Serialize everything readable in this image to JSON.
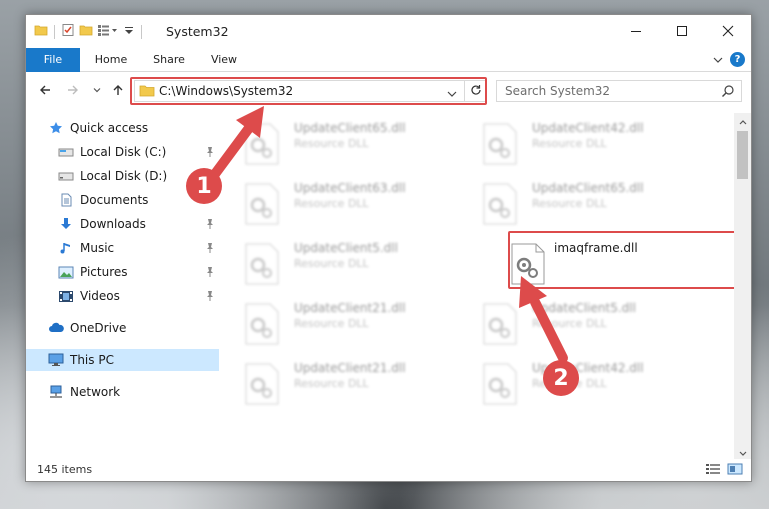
{
  "window": {
    "title": "System32",
    "controls": {
      "minimize": "minimize",
      "maximize": "maximize",
      "close": "close"
    }
  },
  "ribbon": {
    "tabs": [
      {
        "label": "File"
      },
      {
        "label": "Home"
      },
      {
        "label": "Share"
      },
      {
        "label": "View"
      }
    ],
    "help": "?"
  },
  "address": {
    "path": "C:\\Windows\\System32",
    "search_placeholder": "Search System32"
  },
  "nav_pane": {
    "items": [
      {
        "label": "Quick access",
        "icon": "star-icon"
      },
      {
        "label": "Local Disk (C:)",
        "icon": "drive-icon",
        "pinned": true
      },
      {
        "label": "Local Disk (D:)",
        "icon": "drive-icon",
        "pinned": false
      },
      {
        "label": "Documents",
        "icon": "documents-icon",
        "pinned": false
      },
      {
        "label": "Downloads",
        "icon": "download-icon",
        "pinned": true
      },
      {
        "label": "Music",
        "icon": "music-icon",
        "pinned": true
      },
      {
        "label": "Pictures",
        "icon": "pictures-icon",
        "pinned": true
      },
      {
        "label": "Videos",
        "icon": "videos-icon",
        "pinned": true
      },
      {
        "label": "OneDrive",
        "icon": "cloud-icon"
      },
      {
        "label": "This PC",
        "icon": "computer-icon",
        "selected": true
      },
      {
        "label": "Network",
        "icon": "network-icon"
      }
    ]
  },
  "files": [
    {
      "name": "UpdateClient65.dll",
      "type": "Resource DLL"
    },
    {
      "name": "UpdateClient42.dll",
      "type": "Resource DLL"
    },
    {
      "name": "UpdateClient63.dll",
      "type": "Resource DLL"
    },
    {
      "name": "UpdateClient65.dll",
      "type": "Resource DLL"
    },
    {
      "name": "UpdateClient5.dll",
      "type": "Resource DLL"
    },
    {
      "name": "imaqframe.dll",
      "type": ""
    },
    {
      "name": "UpdateClient21.dll",
      "type": "Resource DLL"
    },
    {
      "name": "UpdateClient5.dll",
      "type": "Resource DLL"
    },
    {
      "name": "UpdateClient21.dll",
      "type": "Resource DLL"
    },
    {
      "name": "UpdateClient42.dll",
      "type": "Resource DLL"
    }
  ],
  "status": {
    "item_count": "145 items"
  },
  "callouts": [
    {
      "label": "1"
    },
    {
      "label": "2"
    }
  ],
  "colors": {
    "accent": "#1979ca",
    "highlight": "#dd4b4b",
    "selection": "#cce8ff"
  }
}
